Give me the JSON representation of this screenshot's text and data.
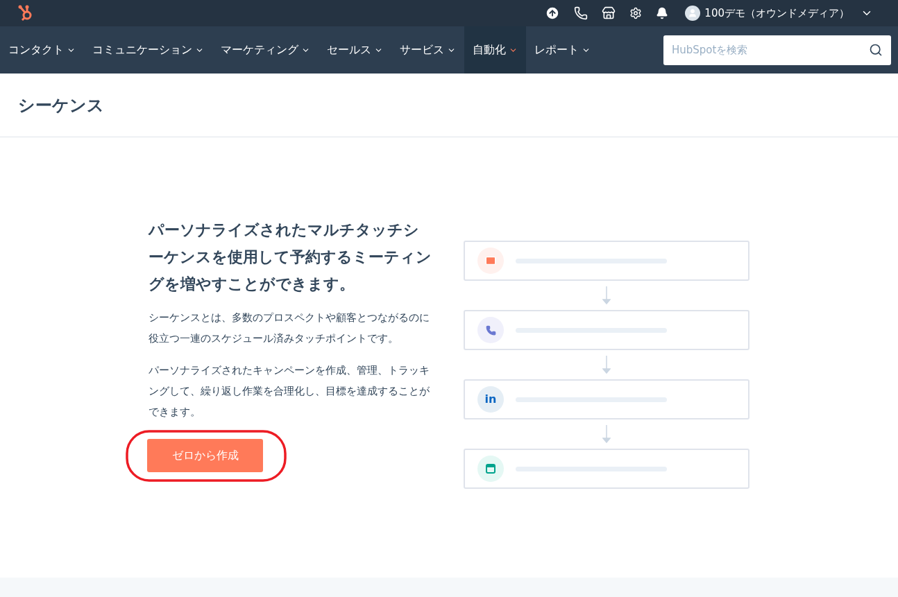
{
  "top_bar": {
    "account": "100デモ（オウンドメディア）"
  },
  "nav": [
    {
      "label": "コンタクト",
      "selected": false
    },
    {
      "label": "コミュニケーション",
      "selected": false
    },
    {
      "label": "マーケティング",
      "selected": false
    },
    {
      "label": "セールス",
      "selected": false
    },
    {
      "label": "サービス",
      "selected": false
    },
    {
      "label": "自動化",
      "selected": true
    },
    {
      "label": "レポート",
      "selected": false
    }
  ],
  "search": {
    "placeholder": "HubSpotを検索"
  },
  "page_title": "シーケンス",
  "headline": "パーソナライズされたマルチタッチシーケンスを使用して予約するミーティングを増やすことができます。",
  "paragraphs": [
    "シーケンスとは、多数のプロスペクトや顧客とつながるのに役立つ一連のスケジュール済みタッチポイントです。",
    "パーソナライズされたキャンペーンを作成、管理、トラッキングして、繰り返し作業を合理化し、目標を達成することができます。"
  ],
  "create_button": "ゼロから作成",
  "steps": [
    {
      "kind": "email"
    },
    {
      "kind": "phone"
    },
    {
      "kind": "linkedin",
      "label": "in"
    },
    {
      "kind": "meeting"
    }
  ]
}
